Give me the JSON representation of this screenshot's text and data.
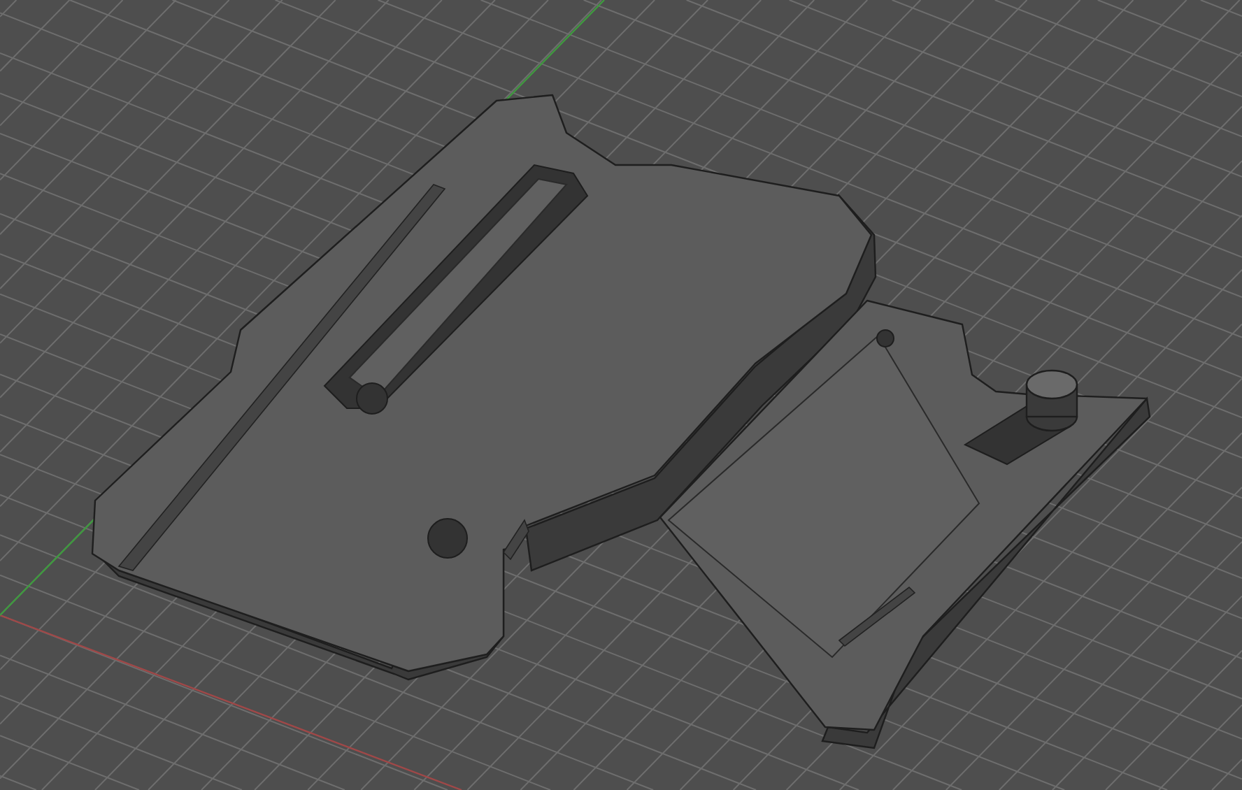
{
  "viewport": {
    "grid": true,
    "axes": [
      {
        "kind": "x",
        "color": "#a04848"
      },
      {
        "kind": "y",
        "color": "#3f9a3f"
      }
    ]
  }
}
